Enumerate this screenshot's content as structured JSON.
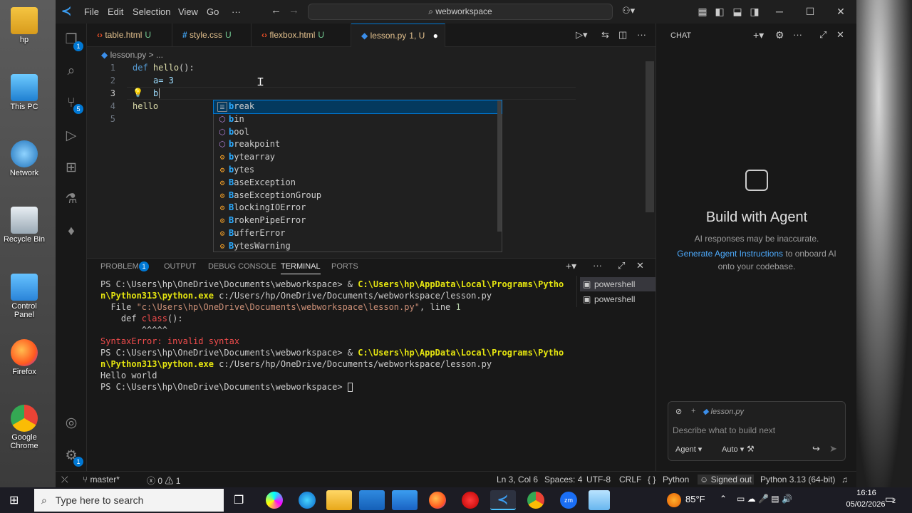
{
  "desktop": {
    "icons": [
      {
        "label": "hp"
      },
      {
        "label": "This PC"
      },
      {
        "label": "Network"
      },
      {
        "label": "Recycle Bin"
      },
      {
        "label": "Control Panel"
      },
      {
        "label": "Firefox"
      },
      {
        "label": "Google Chrome"
      }
    ]
  },
  "titlebar": {
    "menus": [
      "File",
      "Edit",
      "Selection",
      "View",
      "Go",
      "···"
    ],
    "search": "webworkspace"
  },
  "activitybar": {
    "explorer_badge": "1",
    "scm_badge": "5",
    "settings_badge": "1"
  },
  "tabs": [
    {
      "name": "table.html",
      "status": "U"
    },
    {
      "name": "style.css",
      "status": "U"
    },
    {
      "name": "flexbox.html",
      "status": "U"
    },
    {
      "name": "lesson.py",
      "status": "1, U"
    }
  ],
  "editor": {
    "breadcrumb_file": "lesson.py",
    "breadcrumb_rest": "> ...",
    "line_numbers": [
      "1",
      "2",
      "3",
      "4",
      "5"
    ],
    "lines": {
      "l1_kw": "def",
      "l1_fn": "hello",
      "l1_rest": "():",
      "l2": "a= 3",
      "l3": "b",
      "l4": "hello"
    },
    "suggestions": [
      {
        "hl": "b",
        "rest": "reak"
      },
      {
        "hl": "b",
        "rest": "in"
      },
      {
        "hl": "b",
        "rest": "ool"
      },
      {
        "hl": "b",
        "rest": "reakpoint"
      },
      {
        "hl": "b",
        "rest": "ytearray"
      },
      {
        "hl": "b",
        "rest": "ytes"
      },
      {
        "hl": "B",
        "rest": "aseException"
      },
      {
        "hl": "B",
        "rest": "aseExceptionGroup"
      },
      {
        "hl": "B",
        "rest": "lockingIOError"
      },
      {
        "hl": "B",
        "rest": "rokenPipeError"
      },
      {
        "hl": "B",
        "rest": "ufferError"
      },
      {
        "hl": "B",
        "rest": "ytesWarning"
      }
    ]
  },
  "panel": {
    "tabs": [
      "PROBLEMS",
      "OUTPUT",
      "DEBUG CONSOLE",
      "TERMINAL",
      "PORTS"
    ],
    "problems_badge": "1",
    "terminal": {
      "l1a": "PS C:\\Users\\hp\\OneDrive\\Documents\\webworkspace> & ",
      "l1b": "C:\\Users\\hp\\AppData\\Local\\Programs\\Pytho",
      "l2a": "n\\Python313\\python.exe",
      "l2b": " c:/Users/hp/OneDrive/Documents/webworkspace/lesson.py",
      "l3a": "  File ",
      "l3b": "\"c:\\Users\\hp\\OneDrive\\Documents\\webworkspace\\lesson.py\"",
      "l3c": ", line ",
      "l3d": "1",
      "l4a": "    def ",
      "l4b": "class",
      "l4c": "():",
      "l5": "        ^^^^^",
      "l6a": "SyntaxError",
      "l6b": ": invalid syntax",
      "l7a": "PS C:\\Users\\hp\\OneDrive\\Documents\\webworkspace> & ",
      "l7b": "C:\\Users\\hp\\AppData\\Local\\Programs\\Pytho",
      "l8a": "n\\Python313\\python.exe",
      "l8b": " c:/Users/hp/OneDrive/Documents/webworkspace/lesson.py",
      "l9": "Hello world",
      "l10": "PS C:\\Users\\hp\\OneDrive\\Documents\\webworkspace> "
    },
    "terminals": [
      "powershell",
      "powershell"
    ]
  },
  "chat": {
    "header": "CHAT",
    "title": "Build with Agent",
    "subtitle": "AI responses may be inaccurate.",
    "link": "Generate Agent Instructions",
    "link_rest": "to onboard AI",
    "link_rest2": "onto your codebase.",
    "context_file": "lesson.py",
    "placeholder": "Describe what to build next",
    "mode": "Agent",
    "model": "Auto"
  },
  "statusbar": {
    "branch": "master*",
    "errors": "0",
    "warnings": "1",
    "position": "Ln 3, Col 6",
    "spaces": "Spaces: 4",
    "encoding": "UTF-8",
    "eol": "CRLF",
    "braces": "{ }",
    "language": "Python",
    "account": "Signed out",
    "interpreter": "Python 3.13 (64-bit)"
  },
  "taskbar": {
    "search_placeholder": "Type here to search",
    "weather": "85°F",
    "time": "16:16",
    "date": "05/02/2026",
    "notifications": "2"
  },
  "colors": {
    "accent": "#0078d4",
    "status_bg": "#181818",
    "editor_bg": "#1f1f1f"
  }
}
